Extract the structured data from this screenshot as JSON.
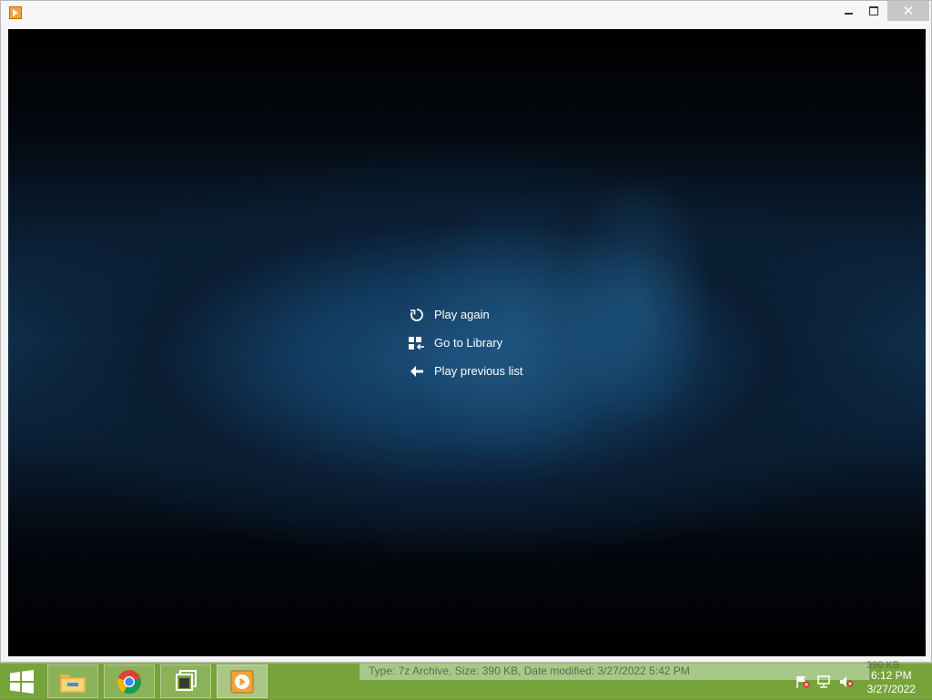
{
  "window": {
    "title": "",
    "controls": {
      "minimize": "minimize",
      "maximize": "maximize",
      "close": "✕"
    }
  },
  "player": {
    "menu": [
      {
        "icon": "replay-icon",
        "label": "Play again"
      },
      {
        "icon": "library-icon",
        "label": "Go to Library"
      },
      {
        "icon": "back-arrow-icon",
        "label": "Play previous list"
      }
    ]
  },
  "taskbar": {
    "tooltip": "Type: 7z Archive, Size: 390 KB, Date modified: 3/27/2022 5:42 PM",
    "tooltip_size": "390 KB",
    "apps": [
      "file-explorer-icon",
      "chrome-icon",
      "task-view-icon",
      "media-player-icon"
    ],
    "tray": [
      "action-center-flag-icon",
      "network-icon",
      "volume-muted-icon"
    ],
    "time": "6:12 PM",
    "date": "3/27/2022"
  },
  "colors": {
    "taskbar": "#77a43a",
    "content_glow": "#1c4f7a",
    "accent_orange": "#f2a33a"
  }
}
